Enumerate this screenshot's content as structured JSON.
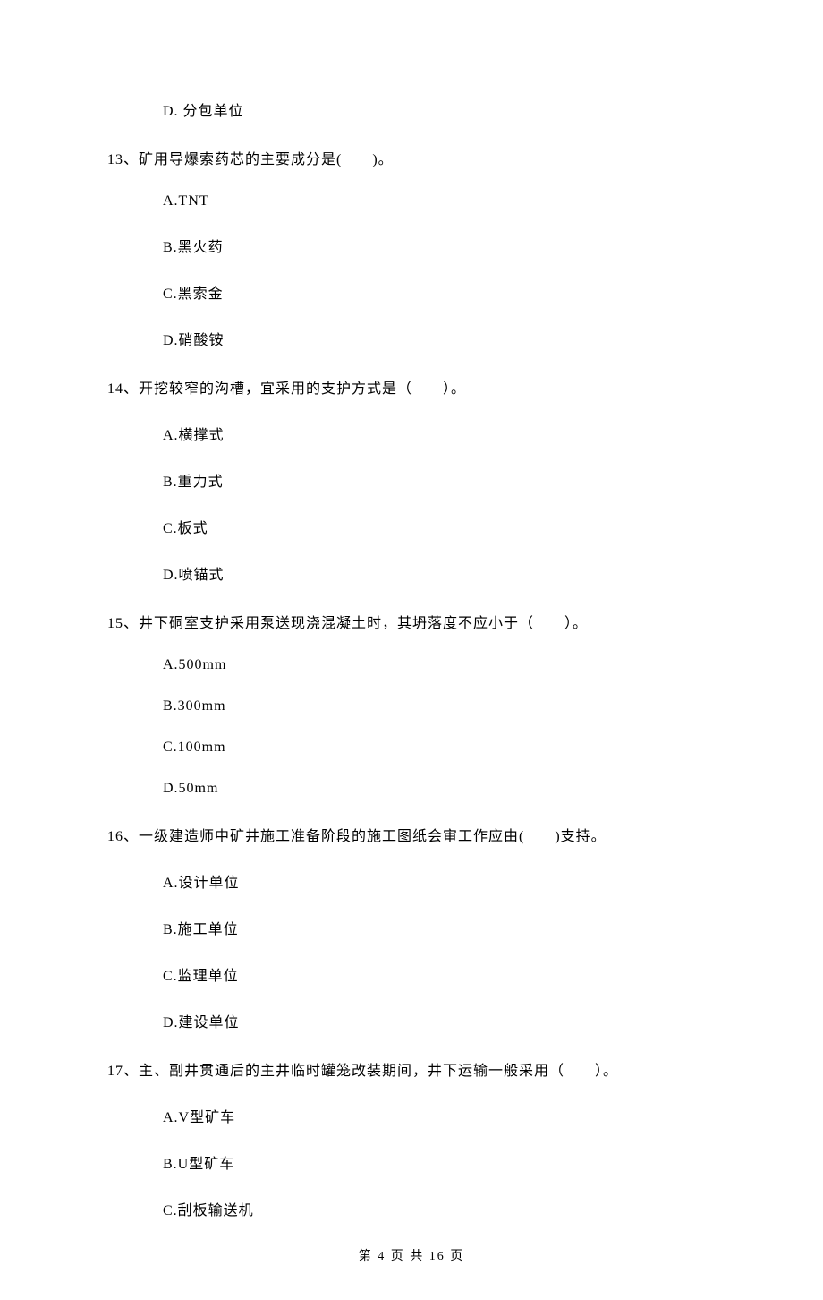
{
  "orphan_option": "D.  分包单位",
  "questions": [
    {
      "stem": "13、矿用导爆索药芯的主要成分是(　　)。",
      "options": [
        "A.TNT",
        "B.黑火药",
        "C.黑索金",
        "D.硝酸铵"
      ]
    },
    {
      "stem": "14、开挖较窄的沟槽，宜采用的支护方式是（　　）。",
      "options": [
        "A.横撑式",
        "B.重力式",
        "C.板式",
        "D.喷锚式"
      ]
    },
    {
      "stem": "15、井下硐室支护采用泵送现浇混凝土时，其坍落度不应小于（　　）。",
      "options": [
        "A.500mm",
        "B.300mm",
        "C.100mm",
        "D.50mm"
      ]
    },
    {
      "stem": "16、一级建造师中矿井施工准备阶段的施工图纸会审工作应由(　　)支持。",
      "options": [
        "A.设计单位",
        "B.施工单位",
        "C.监理单位",
        "D.建设单位"
      ]
    },
    {
      "stem": "17、主、副井贯通后的主井临时罐笼改装期间，井下运输一般采用（　　）。",
      "options": [
        "A.V型矿车",
        "B.U型矿车",
        "C.刮板输送机"
      ]
    }
  ],
  "footer": "第 4 页 共 16 页"
}
